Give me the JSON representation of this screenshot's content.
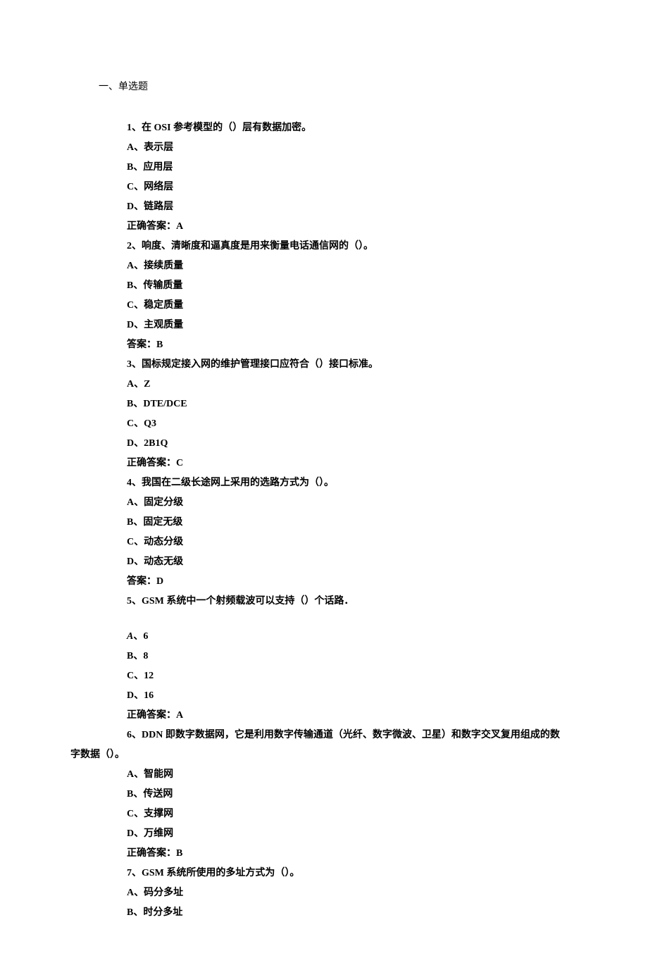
{
  "section_title": "一、单选题",
  "questions": [
    {
      "stem": "1、在 OSI 参考模型的（）层有数据加密。",
      "options": [
        "A、表示层",
        "B、应用层",
        "C、网络层",
        "D、链路层"
      ],
      "answer_label": "正确答案：A"
    },
    {
      "stem": "2、响度、清晰度和逼真度是用来衡量电话通信网的（）。",
      "options": [
        "A、接续质量",
        "B、传输质量",
        "C、稳定质量",
        "D、主观质量"
      ],
      "answer_label": "答案：B"
    },
    {
      "stem": "3、国标规定接入网的维护管理接口应符合（）接口标准。",
      "options": [
        "A、Z",
        "B、DTE/DCE",
        "C、Q3",
        "D、2B1Q"
      ],
      "answer_label": "正确答案：C"
    },
    {
      "stem": "4、我国在二级长途网上采用的选路方式为（）。",
      "options": [
        "A、固定分级",
        "B、固定无级",
        "C、动态分级",
        "D、动态无级"
      ],
      "answer_label": "答案：D"
    },
    {
      "stem": "5、GSM 系统中一个射频载波可以支持（）个话路．",
      "first_option_italic_label": "A",
      "first_option_rest": "、6",
      "options_rest": [
        "B、8",
        "C、12",
        "D、16"
      ],
      "answer_label": "正确答案：A",
      "gap_before_options": true
    },
    {
      "stem_part1": "6、DDN 即数字数据网，它是利用数字传输通道（光纤、数字微波、卫星）和数字交叉复用组成的数",
      "stem_part2": "字数据（）。",
      "options": [
        "A、智能网",
        "B、传送网",
        "C、支撑网",
        "D、万维网"
      ],
      "answer_label": "正确答案：B"
    },
    {
      "stem": "7、GSM 系统所使用的多址方式为（）。",
      "options": [
        "A、码分多址",
        "B、时分多址"
      ]
    }
  ]
}
